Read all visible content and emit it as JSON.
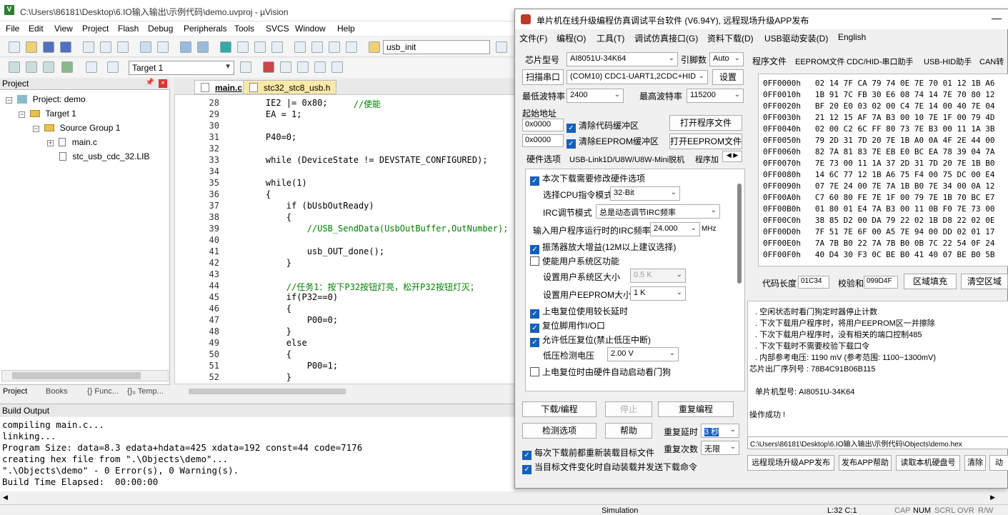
{
  "uvision": {
    "title": "C:\\Users\\86181\\Desktop\\6.IO输入输出\\示例代码\\demo.uvproj - µVision",
    "menu": [
      "File",
      "Edit",
      "View",
      "Project",
      "Flash",
      "Debug",
      "Peripherals",
      "Tools",
      "SVCS",
      "Window",
      "Help"
    ],
    "toolbar_find": "usb_init",
    "target_combo": "Target 1",
    "project_header": "Project",
    "tree": {
      "root": "Project: demo",
      "target": "Target 1",
      "group": "Source Group 1",
      "file1": "main.c",
      "file2": "stc_usb_cdc_32.LIB"
    },
    "panel_tabs": [
      "Project",
      "Books",
      "{} Func...",
      "{}₀ Temp..."
    ],
    "editor_tabs": [
      "main.c",
      "stc32_stc8_usb.h"
    ],
    "code": [
      {
        "n": "28",
        "t": "    IE2 |= 0x80;",
        "c": "                     //使能"
      },
      {
        "n": "29",
        "t": "    EA = 1;",
        "c": ""
      },
      {
        "n": "30",
        "t": "",
        "c": ""
      },
      {
        "n": "31",
        "t": "    P40=0;",
        "c": ""
      },
      {
        "n": "32",
        "t": "",
        "c": ""
      },
      {
        "n": "33",
        "t": "    while (DeviceState != DEVSTATE_CONFIGURED);",
        "c": ""
      },
      {
        "n": "34",
        "t": "",
        "c": ""
      },
      {
        "n": "35",
        "t": "    while(1)",
        "c": ""
      },
      {
        "n": "36",
        "t": "    {",
        "c": ""
      },
      {
        "n": "37",
        "t": "        if (bUsbOutReady)",
        "c": ""
      },
      {
        "n": "38",
        "t": "        {",
        "c": ""
      },
      {
        "n": "39",
        "t": "",
        "c": "            //USB_SendData(UsbOutBuffer,OutNumber);"
      },
      {
        "n": "40",
        "t": "",
        "c": ""
      },
      {
        "n": "41",
        "t": "            usb_OUT_done();",
        "c": ""
      },
      {
        "n": "42",
        "t": "        }",
        "c": ""
      },
      {
        "n": "43",
        "t": "",
        "c": ""
      },
      {
        "n": "44",
        "t": "",
        "c": "        //任务1：按下P32按钮灯亮，松开P32按钮灯灭；"
      },
      {
        "n": "45",
        "t": "        if(P32==0)",
        "c": ""
      },
      {
        "n": "46",
        "t": "        {",
        "c": ""
      },
      {
        "n": "47",
        "t": "            P00=0;",
        "c": ""
      },
      {
        "n": "48",
        "t": "        }",
        "c": ""
      },
      {
        "n": "49",
        "t": "        else",
        "c": ""
      },
      {
        "n": "50",
        "t": "        {",
        "c": ""
      },
      {
        "n": "51",
        "t": "            P00=1;",
        "c": ""
      },
      {
        "n": "52",
        "t": "        }",
        "c": ""
      }
    ],
    "build_header": "Build Output",
    "build_lines": [
      "compiling main.c...",
      "linking...",
      "Program Size: data=8.3 edata+hdata=425 xdata=192 const=44 code=7176",
      "creating hex file from \".\\Objects\\demo\"...",
      "\".\\Objects\\demo\" - 0 Error(s), 0 Warning(s).",
      "Build Time Elapsed:  00:00:00"
    ],
    "status": {
      "mode": "Simulation",
      "pos": "L:32 C:1",
      "cap": "CAP",
      "num": "NUM",
      "scrl": "SCRL",
      "ovr": "OVR",
      "rw": "R/W"
    }
  },
  "stc": {
    "title": "单片机在线升级编程仿真调试平台软件 (V6.94Y), 远程现场升级APP发布",
    "menu": [
      "文件(F)",
      "编程(O)",
      "工具(T)",
      "调试仿真接口(G)",
      "资料下载(D)",
      "USB驱动安装(D)",
      "English"
    ],
    "chip_label": "芯片型号",
    "chip_value": "AI8051U-34K64",
    "pin_label": "引脚数",
    "pin_value": "Auto",
    "scan_button": "扫描串口",
    "port_value": "(COM10) CDC1-UART1,2CDC+HID",
    "settings_button": "设置",
    "min_baud_label": "最低波特率",
    "min_baud_value": "2400",
    "max_baud_label": "最高波特率",
    "max_baud_value": "115200",
    "start_addr_label": "起始地址",
    "addr1": "0x0000",
    "addr2": "0x0000",
    "clear_code": "清除代码缓冲区",
    "clear_eeprom": "清除EEPROM缓冲区",
    "open_prog": "打开程序文件",
    "open_eeprom": "打开EEPROM文件",
    "option_tabs": [
      "硬件选项",
      "USB-Link1D/U8W/U8W-Mini脱机",
      "程序加"
    ],
    "hw": {
      "modify_hw": "本次下载需要修改硬件选项",
      "cpu_mode_label": "选择CPU指令模式",
      "cpu_mode_value": "32-Bit",
      "irc_label": "IRC调节模式",
      "irc_value": "总是动态调节IRC频率",
      "freq_label": "输入用户程序运行时的IRC频率",
      "freq_value": "24.000",
      "freq_unit": "MHz",
      "osc_gain": "振荡器放大增益(12M以上建议选择)",
      "user_sys": "使能用户系统区功能",
      "sys_size_label": "设置用户系统区大小",
      "sys_size_value": "0.5 K",
      "eeprom_size_label": "设置用户EEPROM大小",
      "eeprom_size_value": "1   K",
      "long_reset": "上电复位使用较长延时",
      "reset_io": "复位脚用作I/O口",
      "lvr": "允许低压复位(禁止低压中断)",
      "lvd_label": "低压检测电压",
      "lvd_value": "2.00 V",
      "wdt": "上电复位时由硬件自动启动看门狗"
    },
    "download_button": "下载/编程",
    "stop_button": "停止",
    "reprogram_button": "重复编程",
    "check_button": "检测选项",
    "help_button": "帮助",
    "repeat_delay_label": "重复延时",
    "repeat_delay_value": "3 秒",
    "repeat_count_label": "重复次数",
    "repeat_count_value": "无限",
    "reload_before": "每次下载前都重新装载目标文件",
    "auto_load": "当目标文件变化时自动装载并发送下载命令",
    "right_tabs": [
      "程序文件",
      "EEPROM文件",
      "CDC/HID-串口助手",
      "USB-HID助手",
      "CAN转"
    ],
    "hex_rows": [
      "0FF0000h   02 14 7F CA 79 74 0E 7E 70 01 12 1B A6",
      "0FF0010h   1B 91 7C FB 30 E6 08 74 14 7E 70 80 12",
      "0FF0020h   BF 20 E0 03 02 00 C4 7E 14 00 40 7E 04",
      "0FF0030h   21 12 15 AF 7A B3 00 10 7E 1F 00 79 4D",
      "0FF0040h   02 00 C2 6C FF 80 73 7E B3 00 11 1A 3B",
      "0FF0050h   79 2D 31 7D 20 7E 1B A0 0A 4F 2E 44 00",
      "0FF0060h   82 7A 81 83 7E EB E0 BC EA 78 39 04 7A",
      "0FF0070h   7E 73 00 11 1A 37 2D 31 7D 20 7E 1B B0",
      "0FF0080h   14 6C 77 12 1B A6 75 F4 00 75 DC 00 E4",
      "0FF0090h   07 7E 24 00 7E 7A 1B B0 7E 34 00 0A 12",
      "0FF00A0h   C7 60 80 FE 7E 1F 00 79 7E 1B 70 BC E7",
      "0FF00B0h   01 80 01 E4 7A B3 00 11 0B F0 7E 73 00",
      "0FF00C0h   38 85 D2 00 DA 79 22 02 1B D8 22 02 0E",
      "0FF00D0h   7F 51 7E 6F 00 A5 7E 94 00 DD 02 01 17",
      "0FF00E0h   7A 7B B0 22 7A 7B B0 0B 7C 22 54 0F 24",
      "0FF00F0h   40 D4 30 F3 0C BE B0 41 40 07 BE B0 5B"
    ],
    "code_len_label": "代码长度",
    "code_len_value": "01C34",
    "checksum_label": "校验和",
    "checksum_value": "099D4F",
    "fill_button": "区域填充",
    "clear_area_button": "清空区域",
    "log_lines": [
      ". 空闲状态时看门狗定时器停止计数",
      ". 下次下载用户程序时，将用户EEPROM区一并擦除",
      ". 下次下载用户程序时，没有相关的端口控制485",
      ". 下次下载时不需要校验下载口令",
      ". 内部参考电压: 1190 mV (参考范围: 1100~1300mV)",
      "芯片出厂序列号 : 78B4C91B06B115",
      "",
      "单片机型号: AI8051U-34K64",
      "",
      "操作成功 !"
    ],
    "path": "C:\\Users\\86181\\Desktop\\6.IO输入输出\\示例代码\\Objects\\demo.hex",
    "bottom_buttons": [
      "远程现场升级APP发布",
      "发布APP帮助",
      "读取本机硬盘号",
      "清除",
      "动"
    ]
  }
}
